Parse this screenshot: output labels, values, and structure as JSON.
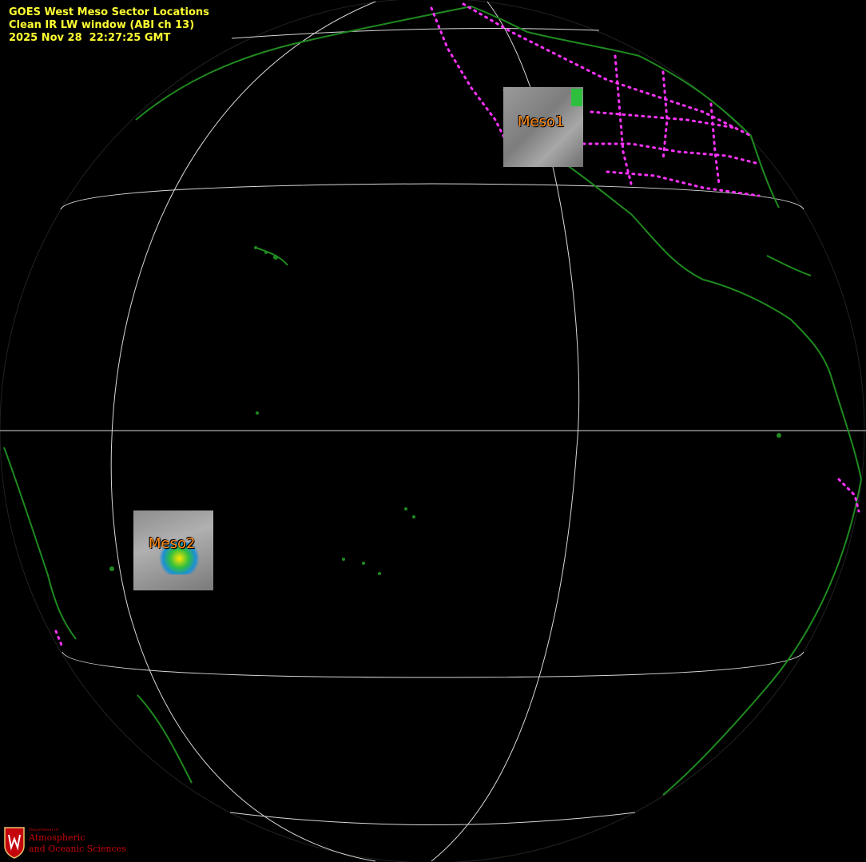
{
  "header": {
    "line1": "GOES West Meso Sector Locations",
    "line2": "Clean IR LW window (ABI ch 13)",
    "line3": "2025 Nov 28  22:27:25 GMT"
  },
  "sectors": [
    {
      "label": "Meso1"
    },
    {
      "label": "Meso2"
    }
  ],
  "logo": {
    "dept": "Department of",
    "line1": "Atmospheric",
    "line2": "and Oceanic Sciences"
  },
  "colors": {
    "background": "#000000",
    "title": "#ffff33",
    "coastline": "#1f8a1f",
    "borders": "#ff33ff",
    "graticule": "#d8d8d8",
    "meso_label": "#ff8c1a",
    "logo": "#c5050c"
  }
}
